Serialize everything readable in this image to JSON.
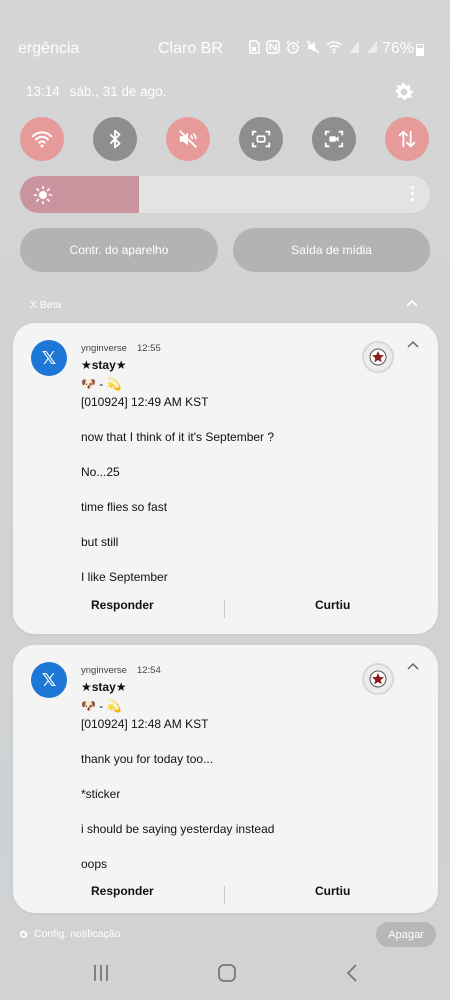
{
  "status_bar": {
    "left_text": "ergência",
    "carrier": "Claro BR",
    "battery": "76%",
    "icons": [
      "sim-icon",
      "nfc-icon",
      "alarm-icon",
      "mute-icon",
      "wifi-icon",
      "signal-icon",
      "signal-icon"
    ]
  },
  "panel": {
    "time": "13:14",
    "date": "sáb., 31 de ago.",
    "quick_toggles": [
      {
        "name": "wifi",
        "icon": "wifi-icon",
        "state": "on"
      },
      {
        "name": "bluetooth",
        "icon": "bluetooth-icon",
        "state": "off"
      },
      {
        "name": "sound",
        "icon": "mute-icon",
        "state": "on"
      },
      {
        "name": "screenshot",
        "icon": "screen-capture-icon",
        "state": "off"
      },
      {
        "name": "screen-record",
        "icon": "screen-record-icon",
        "state": "off"
      },
      {
        "name": "mobile-data",
        "icon": "data-transfer-icon",
        "state": "on"
      }
    ],
    "brightness_level": 0.29,
    "device_control_label": "Contr. do aparelho",
    "media_output_label": "Saída de mídia"
  },
  "colors": {
    "toggle_on": "#e79a9a",
    "toggle_off": "#8e8e8e",
    "x_brand": "#1d77d6",
    "brightness_fill": "#c9949e"
  },
  "group": {
    "app_name": "X Beta"
  },
  "notifications": [
    {
      "app_icon": "x-logo-icon",
      "app_logo_glyph": "𝕏",
      "username": "ynginverse",
      "time": "12:55",
      "title": "★stay★",
      "emoji_line": "🐶 - 💫",
      "lines": [
        "[010924] 12:49 AM KST",
        "",
        "now that I think of it it's September ?",
        "",
        "No...25",
        "",
        "time flies so fast",
        "",
        "but still",
        "",
        "I like September"
      ],
      "reply_label": "Responder",
      "like_label": "Curtiu"
    },
    {
      "app_icon": "x-logo-icon",
      "app_logo_glyph": "𝕏",
      "username": "ynginverse",
      "time": "12:54",
      "title": "★stay★",
      "emoji_line": "🐶 - 💫",
      "lines": [
        "[010924] 12:48 AM KST",
        "",
        "thank you for today too...",
        "",
        "*sticker",
        "",
        "i should be saying yesterday instead",
        "",
        "oops"
      ],
      "reply_label": "Responder",
      "like_label": "Curtiu"
    }
  ],
  "footer": {
    "settings_label": "Config. notificação",
    "clear_label": "Apagar"
  }
}
